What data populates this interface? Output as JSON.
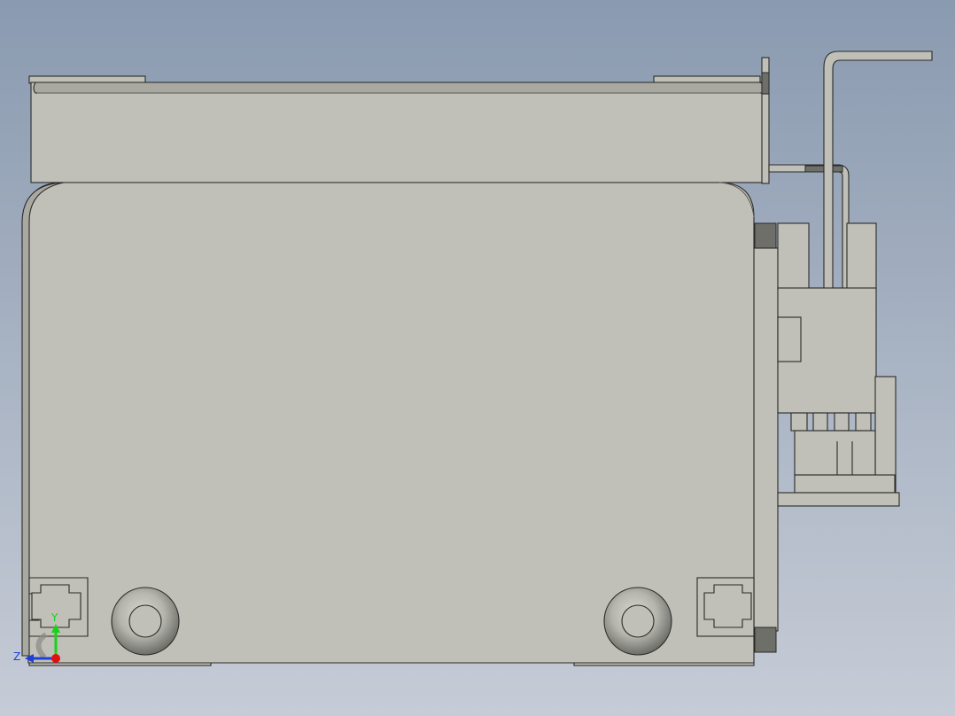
{
  "view": {
    "background_top": "#8a9ab0",
    "background_bottom": "#c6ccd6",
    "part_color": "#c0c0b8",
    "edge_color": "#2a2a28"
  },
  "triad": {
    "y_label": "Y",
    "z_label": "Z",
    "y_color": "#19d219",
    "z_color": "#1f3fd6",
    "origin_color": "#e01010"
  }
}
